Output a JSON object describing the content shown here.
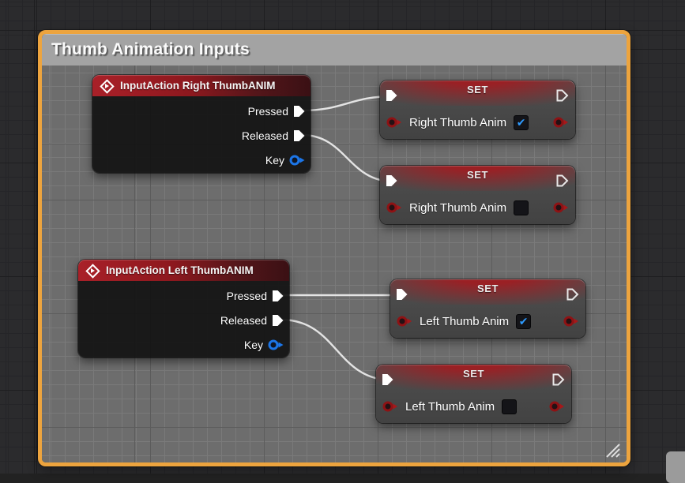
{
  "graph": {
    "comment": {
      "title": "Thumb Animation Inputs"
    },
    "input_nodes": [
      {
        "title": "InputAction Right ThumbANIM",
        "pins": {
          "pressed": "Pressed",
          "released": "Released",
          "key": "Key"
        }
      },
      {
        "title": "InputAction Left ThumbANIM",
        "pins": {
          "pressed": "Pressed",
          "released": "Released",
          "key": "Key"
        }
      }
    ],
    "set_nodes": [
      {
        "header": "SET",
        "variable": "Right Thumb Anim",
        "checked": true,
        "check_glyph": "✔"
      },
      {
        "header": "SET",
        "variable": "Right Thumb Anim",
        "checked": false,
        "check_glyph": ""
      },
      {
        "header": "SET",
        "variable": "Left Thumb Anim",
        "checked": true,
        "check_glyph": "✔"
      },
      {
        "header": "SET",
        "variable": "Left Thumb Anim",
        "checked": false,
        "check_glyph": ""
      }
    ],
    "colors": {
      "comment_border": "#eda43e",
      "comment_header": "#a3a3a3",
      "event_header_red": "#9e1b21",
      "set_body": "#484848",
      "exec_pin": "#ffffff",
      "bool_pin": "#8e1214",
      "key_pin": "#1c76e8",
      "wire": "#e9e9e9",
      "checkbox_check": "#2e9bff"
    }
  }
}
